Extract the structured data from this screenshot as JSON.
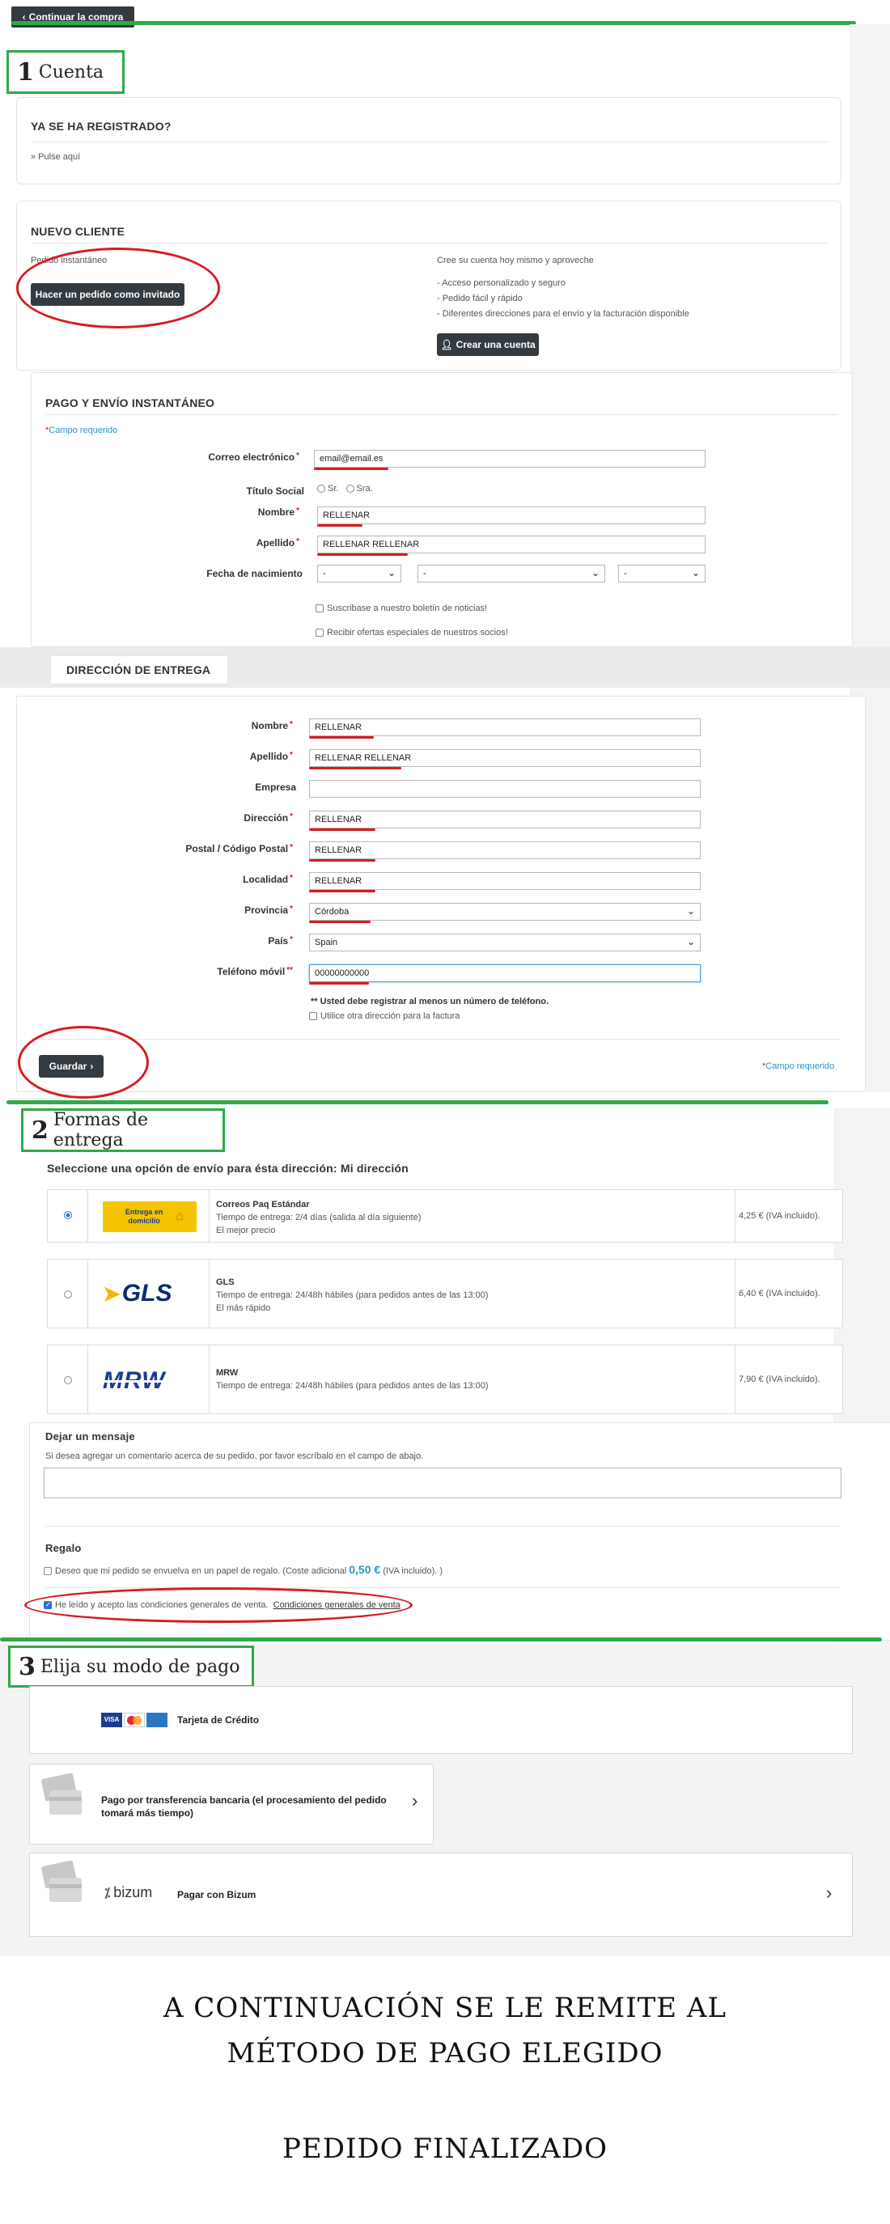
{
  "top": {
    "continue_label": "Continuar la compra"
  },
  "section1": {
    "num": "1",
    "title": "Cuenta",
    "registered_title": "YA SE HA REGISTRADO?",
    "registered_link": "» Pulse aquí",
    "new_client_title": "NUEVO CLIENTE",
    "instant_order": "Pedido instantáneo",
    "guest_button": "Hacer un pedido como invitado",
    "create_text": "Cree su cuenta hoy mismo y aproveche",
    "benefits": [
      "- Acceso personalizado y seguro",
      "- Pedido fácil y rápido",
      "- Diferentes direcciones para el envío y la facturación disponible"
    ],
    "create_button": "Crear una cuenta"
  },
  "instant_form": {
    "title": "PAGO Y ENVÍO INSTANTÁNEO",
    "required_note": "Campo requerido",
    "email_label": "Correo electrónico",
    "email_value": "email@email.es",
    "title_label": "Título Social",
    "opt_sr": "Sr.",
    "opt_sra": "Sra.",
    "name_label": "Nombre",
    "name_value": "RELLENAR",
    "surname_label": "Apellido",
    "surname_value": "RELLENAR RELLENAR",
    "birth_label": "Fecha de nacimiento",
    "birth_day": "-",
    "birth_month": "-",
    "birth_year": "-",
    "newsletter": "Suscribase a nuestro boletín de noticias!",
    "offers": "Recibir ofertas especiales de nuestros socios!"
  },
  "delivery": {
    "title": "DIRECCIÓN DE ENTREGA",
    "name_label": "Nombre",
    "name_value": "RELLENAR",
    "surname_label": "Apellido",
    "surname_value": "RELLENAR RELLENAR",
    "company_label": "Empresa",
    "company_value": "",
    "address_label": "Dirección",
    "address_value": "RELLENAR",
    "postal_label": "Postal / Código Postal",
    "postal_value": "RELLENAR",
    "city_label": "Localidad",
    "city_value": "RELLENAR",
    "province_label": "Provincia",
    "province_value": "Córdoba",
    "country_label": "País",
    "country_value": "Spain",
    "phone_label": "Teléfono móvil",
    "phone_value": "00000000000",
    "phone_note": "** Usted debe registrar al menos un número de teléfono.",
    "other_address": "Utilice otra dirección para la factura",
    "save_button": "Guardar",
    "required_note": "Campo requerido"
  },
  "section2": {
    "num": "2",
    "title": "Formas de entrega",
    "subtitle": "Seleccione una opción de envío para ésta dirección: Mi dirección",
    "carriers": [
      {
        "logo": "Entrega en domicilio",
        "name": "Correos Paq Estándar",
        "time": "Tiempo de entrega: 2/4 días (salida al día siguiente)",
        "extra": "El mejor precio",
        "price": "4,25 € (IVA incluido)."
      },
      {
        "logo": "GLS",
        "name": "GLS",
        "time": "Tiempo de entrega: 24/48h hábiles (para pedidos antes de las 13:00)",
        "extra": "El más rápido",
        "price": "6,40 € (IVA incluido)."
      },
      {
        "logo": "MRW",
        "name": "MRW",
        "time": "Tiempo de entrega: 24/48h hábiles (para pedidos antes de las 13:00)",
        "extra": "",
        "price": "7,90 € (IVA incluido)."
      }
    ],
    "message_title": "Dejar un mensaje",
    "message_text": "Si desea agregar un comentario acerca de su pedido, por favor escríbalo en el campo de abajo.",
    "gift_title": "Regalo",
    "gift_text": "Deseo que mi pedido se envuelva en un papel de regalo.  (Coste adicional",
    "gift_price": "0,50 €",
    "gift_tail": "(IVA incluido). )",
    "terms_text": "He leído y acepto las condiciones generales de venta.",
    "terms_link": "Condiciones generales de venta"
  },
  "section3": {
    "num": "3",
    "title": "Elija su modo de pago",
    "card_label": "Tarjeta de Crédito",
    "transfer_label": "Pago por transferencia bancaria (el procesamiento del pedido tomará más tiempo)",
    "bizum_brand": "bizum",
    "bizum_label": "Pagar con Bizum"
  },
  "footer": {
    "line1": "A CONTINUACIÓN SE LE REMITE AL",
    "line2": "MÉTODO DE PAGO ELEGIDO",
    "line3": "PEDIDO FINALIZADO"
  },
  "colors": {
    "green": "#2eaa4a",
    "red": "#d81b22",
    "dark_button": "#333a40",
    "link": "#2a95c7"
  }
}
